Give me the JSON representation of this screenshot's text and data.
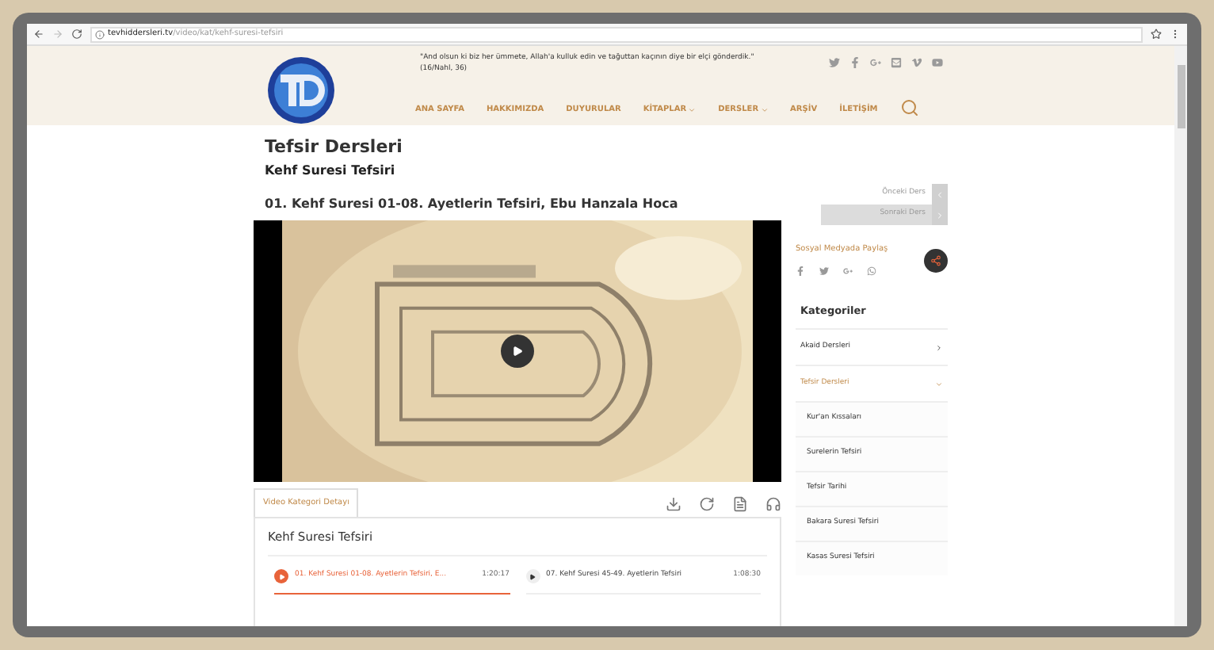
{
  "browser": {
    "url_host": "tevhiddersleri.tv",
    "url_path": "/video/kat/kehf-suresi-tefsiri"
  },
  "header": {
    "quote": "\"And olsun ki biz her ümmete, Allah'a kulluk edin ve tağuttan kaçının diye bir elçi gönderdik.\"",
    "quote_source": "(16/Nahl, 36)"
  },
  "nav": [
    {
      "label": "ANA SAYFA",
      "has_dropdown": false
    },
    {
      "label": "HAKKIMIZDA",
      "has_dropdown": false
    },
    {
      "label": "DUYURULAR",
      "has_dropdown": false
    },
    {
      "label": "KİTAPLAR",
      "has_dropdown": true
    },
    {
      "label": "DERSLER",
      "has_dropdown": true
    },
    {
      "label": "ARŞİV",
      "has_dropdown": false
    },
    {
      "label": "İLETİŞİM",
      "has_dropdown": false
    }
  ],
  "page_title": "Tefsir Dersleri",
  "subtitle": "Kehf Suresi Tefsiri",
  "video_title": "01. Kehf Suresi 01-08. Ayetlerin Tefsiri, Ebu Hanzala Hoca",
  "lesson_nav": [
    {
      "label": "Önceki Ders",
      "kind": "prev"
    },
    {
      "label": "Sonraki Ders",
      "kind": "next"
    }
  ],
  "share": {
    "title": "Sosyal Medyada Paylaş"
  },
  "categories": {
    "title": "Kategoriler",
    "items": [
      {
        "label": "Akaid Dersleri",
        "expanded": false
      },
      {
        "label": "Tefsir Dersleri",
        "expanded": true,
        "children": [
          {
            "label": "Kur'an Kıssaları"
          },
          {
            "label": "Surelerin Tefsiri"
          },
          {
            "label": "Tefsir Tarihi"
          },
          {
            "label": "Bakara Suresi Tefsiri"
          },
          {
            "label": "Kasas Suresi Tefsiri"
          }
        ]
      }
    ]
  },
  "tabs": [
    {
      "label": "Video Kategori Detayı",
      "selected": true
    }
  ],
  "playlist": {
    "title": "Kehf Suresi Tefsiri",
    "items": [
      {
        "title": "01. Kehf Suresi 01-08. Ayetlerin Tefsiri, E...",
        "duration": "1:20:17",
        "playing": true
      },
      {
        "title": "07. Kehf Suresi 45-49. Ayetlerin Tefsiri",
        "duration": "1:08:30",
        "playing": false
      }
    ]
  }
}
